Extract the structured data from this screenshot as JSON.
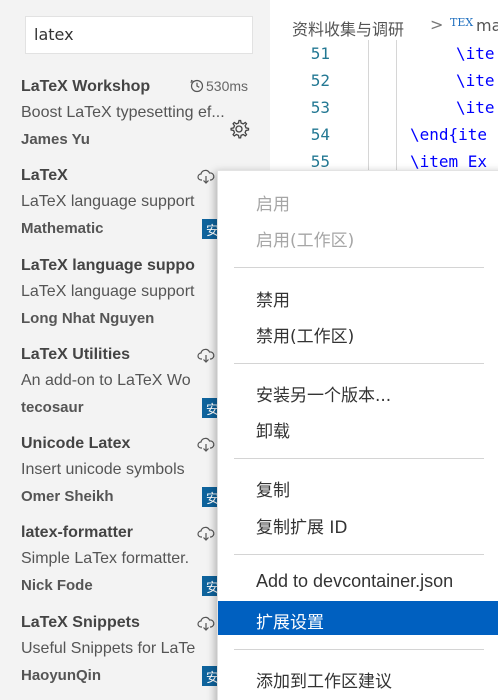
{
  "search": {
    "value": "latex"
  },
  "extensions": [
    {
      "name": "LaTeX Workshop",
      "description": "Boost LaTeX typesetting ef...",
      "author": "James Yu",
      "activation": "530ms",
      "installed": true
    },
    {
      "name": "LaTeX",
      "description": "LaTeX language support",
      "author": "Mathematic",
      "install_label": "安"
    },
    {
      "name": "LaTeX language suppo",
      "description": "LaTeX language support",
      "author": "Long Nhat Nguyen"
    },
    {
      "name": "LaTeX Utilities",
      "description": "An add-on to LaTeX Wo",
      "author": "tecosaur",
      "install_label": "安"
    },
    {
      "name": "Unicode Latex",
      "description": "Insert unicode symbols",
      "author": "Omer Sheikh",
      "install_label": "安"
    },
    {
      "name": "latex-formatter",
      "description": "Simple LaTex formatter.",
      "author": "Nick Fode",
      "install_label": "安"
    },
    {
      "name": "LaTeX Snippets",
      "description": "Useful Snippets for LaTe",
      "author": "HaoyunQin",
      "install_label": "安"
    }
  ],
  "editor": {
    "breadcrumb": {
      "folder": "资料收集与调研",
      "separator": ">",
      "file_type": "TEX",
      "file": "ma"
    },
    "lines": [
      {
        "number": "51",
        "code": "\\ite"
      },
      {
        "number": "52",
        "code": "\\ite"
      },
      {
        "number": "53",
        "code": "\\ite"
      },
      {
        "number": "54",
        "code": "\\end{ite"
      },
      {
        "number": "55",
        "code": "\\item Ex"
      }
    ]
  },
  "context_menu": {
    "items": [
      {
        "label": "启用",
        "disabled": true
      },
      {
        "label": "启用(工作区)",
        "disabled": true
      },
      {
        "label": "禁用"
      },
      {
        "label": "禁用(工作区)"
      },
      {
        "label": "安装另一个版本..."
      },
      {
        "label": "卸载"
      },
      {
        "label": "复制"
      },
      {
        "label": "复制扩展 ID"
      },
      {
        "label": "Add to devcontainer.json"
      },
      {
        "label": "扩展设置",
        "active": true
      },
      {
        "label": "添加到工作区建议"
      }
    ]
  },
  "colors": {
    "accent": "#0060c0",
    "install_button": "#0e639c",
    "line_number": "#237893",
    "keyword": "#0000ff"
  }
}
